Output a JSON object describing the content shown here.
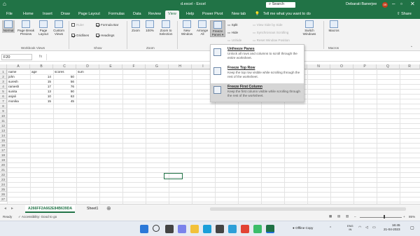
{
  "window": {
    "qat": "⌂",
    "title": "d.excel - Excel",
    "search": "Search",
    "user": "Debarati Banerjee",
    "initials": "DB"
  },
  "menu_tabs": [
    "File",
    "Home",
    "Insert",
    "Draw",
    "Page Layout",
    "Formulas",
    "Data",
    "Review",
    "View",
    "Help",
    "Power Pivot",
    "New tab"
  ],
  "tell_me": "Tell me what you want to do",
  "share": "Share",
  "ribbon": {
    "views": {
      "normal": "Normal",
      "page_break": "Page Break Preview",
      "page_layout": "Page Layout",
      "custom": "Custom Views",
      "group": "Workbook Views"
    },
    "show": {
      "ruler": "Ruler",
      "formula_bar": "Formula Bar",
      "gridlines": "Gridlines",
      "headings": "Headings",
      "group": "Show"
    },
    "zoom": {
      "zoom": "Zoom",
      "hundred": "100%",
      "to_selection": "Zoom to Selection",
      "group": "Zoom"
    },
    "window": {
      "new_window": "New Window",
      "arrange_all": "Arrange All",
      "freeze_panes": "Freeze Panes",
      "split": "Split",
      "hide": "Hide",
      "unhide": "Unhide",
      "side_by_side": "View Side by Side",
      "sync_scroll": "Synchronous Scrolling",
      "reset_pos": "Reset Window Position",
      "switch": "Switch Windows",
      "group": "Window"
    },
    "macros": {
      "macros": "Macros",
      "group": "Macros"
    }
  },
  "formula_bar": {
    "name_box": "F20"
  },
  "freeze_menu": [
    {
      "title": "Unfreeze Panes",
      "desc": "Unlock all rows and columns to scroll through the entire worksheet."
    },
    {
      "title": "Freeze Top Row",
      "desc": "Keep the top row visible while scrolling through the rest of the worksheet."
    },
    {
      "title": "Freeze First Column",
      "desc": "Keep the first column visible while scrolling through the rest of the worksheet."
    }
  ],
  "columns": [
    "A",
    "B",
    "C",
    "D",
    "E",
    "F",
    "G",
    "H",
    "I",
    "J",
    "K",
    "L",
    "M",
    "N",
    "O",
    "P",
    "Q",
    "R"
  ],
  "rows": [
    "1",
    "2",
    "3",
    "4",
    "5",
    "6",
    "7",
    "8",
    "9",
    "10",
    "11",
    "12",
    "13",
    "14",
    "15",
    "16",
    "17",
    "18",
    "19",
    "20",
    "21",
    "22",
    "23",
    "24",
    "25",
    "26",
    "27"
  ],
  "table": [
    [
      "name",
      "age",
      "scores",
      "sum"
    ],
    [
      "john",
      "14",
      "50",
      ""
    ],
    [
      "suresh",
      "15",
      "56",
      ""
    ],
    [
      "ramesh",
      "17",
      "76",
      ""
    ],
    [
      "sunita",
      "13",
      "90",
      ""
    ],
    [
      "anjali",
      "10",
      "63",
      ""
    ],
    [
      "monika",
      "15",
      "45",
      ""
    ]
  ],
  "sheets": [
    "A266FF2A662E84B639DA",
    "Sheet1"
  ],
  "status": {
    "ready": "Ready",
    "accessibility": "Accessibility: Good to go",
    "zoom": "85%"
  },
  "taskbar": {
    "office": "Offline Copy",
    "lang": "ENG",
    "region": "IN",
    "time": "16:45",
    "date": "21-04-2023"
  },
  "colors": {
    "excel_green": "#217346",
    "selection": "#217346"
  }
}
